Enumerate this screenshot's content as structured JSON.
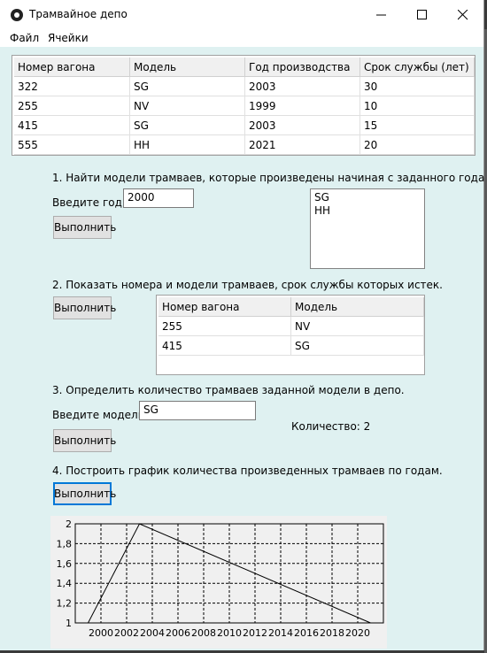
{
  "window": {
    "title": "Трамвайное депо"
  },
  "menu": {
    "items": [
      "Файл",
      "Ячейки"
    ]
  },
  "depot_table": {
    "columns": [
      "Номер вагона",
      "Модель",
      "Год производства",
      "Срок службы (лет)"
    ],
    "rows": [
      [
        "322",
        "SG",
        "2003",
        "30"
      ],
      [
        "255",
        "NV",
        "1999",
        "10"
      ],
      [
        "415",
        "SG",
        "2003",
        "15"
      ],
      [
        "555",
        "HH",
        "2021",
        "20"
      ]
    ]
  },
  "task1": {
    "heading": "1. Найти модели трамваев, которые произведены начиная с заданного года.",
    "input_label": "Введите год:",
    "input_value": "2000",
    "button": "Выполнить",
    "results": [
      "SG",
      "HH"
    ]
  },
  "task2": {
    "heading": "2. Показать номера и модели трамваев, срок службы которых истек.",
    "button": "Выполнить",
    "columns": [
      "Номер вагона",
      "Модель"
    ],
    "rows": [
      [
        "255",
        "NV"
      ],
      [
        "415",
        "SG"
      ]
    ]
  },
  "task3": {
    "heading": "3. Определить количество трамваев заданной модели в депо.",
    "input_label": "Введите модель:",
    "input_value": "SG",
    "button": "Выполнить",
    "result": "Количество: 2"
  },
  "task4": {
    "heading": "4. Построить график количества произведенных трамваев по годам.",
    "button": "Выполнить"
  },
  "chart_data": {
    "type": "line",
    "x": [
      1999,
      2003,
      2021
    ],
    "series": [
      {
        "values": [
          1,
          2,
          1
        ]
      }
    ],
    "xlim": [
      1998,
      2022
    ],
    "ylim": [
      1,
      2
    ],
    "xticks": [
      "2000",
      "2002",
      "2004",
      "2006",
      "2008",
      "2010",
      "2012",
      "2014",
      "2016",
      "2018",
      "2020"
    ],
    "yticks": [
      "1",
      "1,2",
      "1,4",
      "1,6",
      "1,8",
      "2"
    ],
    "grid": true,
    "title": "",
    "xlabel": "",
    "ylabel": ""
  },
  "colors": {
    "window_bg": "#dff1f1",
    "header_bg": "#f0f0f0",
    "focus": "#0078d7"
  },
  "icons": [
    "app-icon",
    "minimize-icon",
    "maximize-icon",
    "close-icon"
  ]
}
